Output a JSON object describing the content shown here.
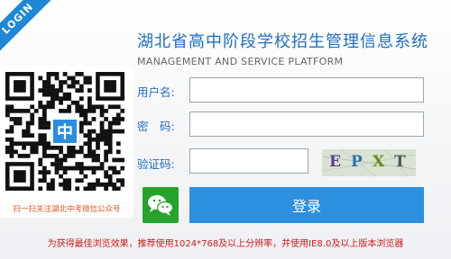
{
  "header": {
    "ribbon": "LOGIN",
    "title": "湖北省高中阶段学校招生管理信息系统",
    "subtitle": "MANAGEMENT AND SERVICE PLATFORM"
  },
  "qr": {
    "caption": "扫一扫关注湖北中考微信公众号"
  },
  "form": {
    "username_label": "用户名:",
    "username_value": "",
    "password_label": "密　码:",
    "password_value": "",
    "captcha_label": "验证码:",
    "captcha_value": "",
    "captcha_chars": [
      "E",
      "P",
      "X",
      "T"
    ],
    "login_label": "登录"
  },
  "footer": {
    "notice": "为获得最佳浏览效果，推荐使用1024*768及以上分辨率，并使用IE8.0及以上版本浏览器"
  },
  "colors": {
    "accent": "#1c6fc1",
    "button": "#2d8fe0",
    "wechat": "#26a32c",
    "notice": "#d11a1a"
  }
}
